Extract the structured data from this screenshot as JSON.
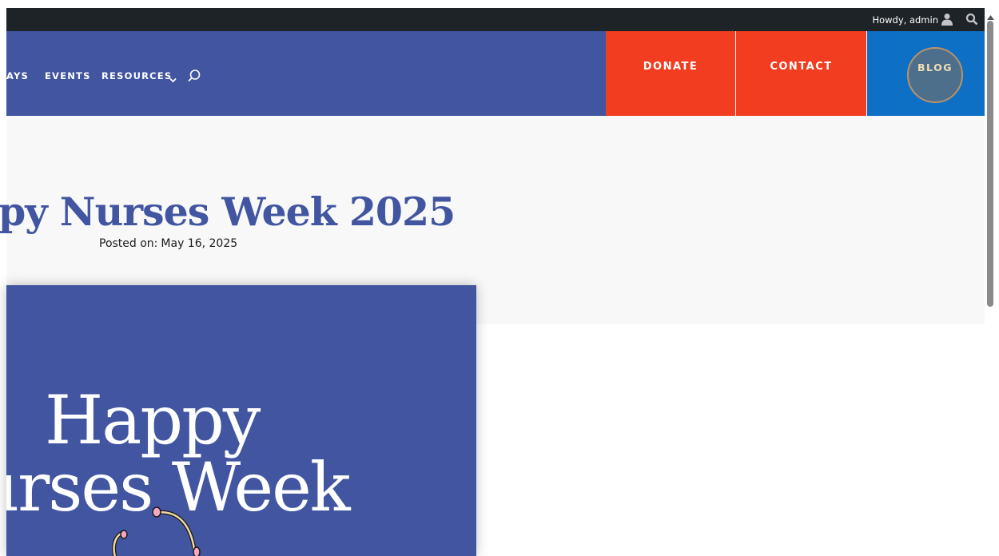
{
  "adminbar": {
    "greeting": "Howdy, admin",
    "user_icon": "user-icon",
    "search_icon": "search-icon"
  },
  "nav": {
    "items": [
      {
        "label": "AYS"
      },
      {
        "label": "EVENTS"
      },
      {
        "label": "RESOURCES",
        "has_dropdown": true
      }
    ],
    "search_icon": "search-icon"
  },
  "cta": {
    "donate": "DONATE",
    "contact": "CONTACT",
    "blog": "BLOG"
  },
  "post": {
    "title": "py Nurses Week 2025",
    "posted_label": "Posted on:",
    "posted_date": "May 16, 2025"
  },
  "hero": {
    "line1": "Happy",
    "line2": "urses Week"
  },
  "colors": {
    "nav_bg": "#4155a1",
    "donate_bg": "#f23d20",
    "blog_bg": "#0e70c5",
    "adminbar_bg": "#1d2327"
  }
}
